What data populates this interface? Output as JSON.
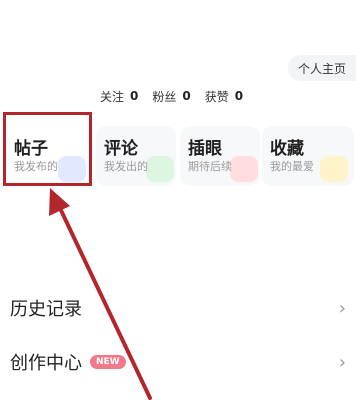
{
  "header": {
    "profile_button": "个人主页"
  },
  "stats": [
    {
      "label": "关注",
      "value": "0"
    },
    {
      "label": "粉丝",
      "value": "0"
    },
    {
      "label": "获赞",
      "value": "0"
    }
  ],
  "cards": [
    {
      "title": "帖子",
      "subtitle": "我发布的",
      "accent": "#dfe6ff"
    },
    {
      "title": "评论",
      "subtitle": "我发出的",
      "accent": "#d9f5df"
    },
    {
      "title": "插眼",
      "subtitle": "期待后续",
      "accent": "#ffd9de"
    },
    {
      "title": "收藏",
      "subtitle": "我的最爱",
      "accent": "#fff2c7"
    }
  ],
  "menu": {
    "history": "历史记录",
    "creator_center": "创作中心",
    "new_badge": "NEW",
    "chevron": "›"
  },
  "annotation": {
    "box_color": "#b3262b",
    "arrow_color": "#b3262b"
  }
}
